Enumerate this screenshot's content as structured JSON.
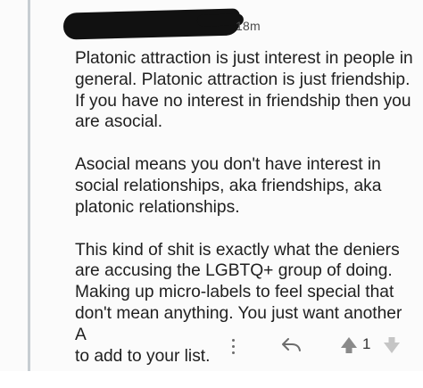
{
  "comment": {
    "timestamp": "18m",
    "paragraphs": [
      "Platonic attraction is just interest in people in\ngeneral. Platonic attraction is just friendship.\nIf you have no interest in friendship then you\nare asocial.",
      "Asocial means you don't have interest in\nsocial relationships, aka friendships, aka\nplatonic relationships.",
      "This kind of shit is exactly what the deniers\nare accusing the LGBTQ+ group of doing.\nMaking up micro-labels to feel special that\ndon't mean anything. You just want another A\nto add to your list."
    ]
  },
  "actions": {
    "vote_count": "1",
    "icons": {
      "more": "more-vertical-icon",
      "reply": "reply-icon",
      "upvote": "upvote-icon",
      "downvote": "downvote-icon"
    }
  },
  "colors": {
    "background": "#fbfbfb",
    "thread_line": "#c6cdd2",
    "text": "#202020",
    "icon": "#6c6c6c"
  }
}
